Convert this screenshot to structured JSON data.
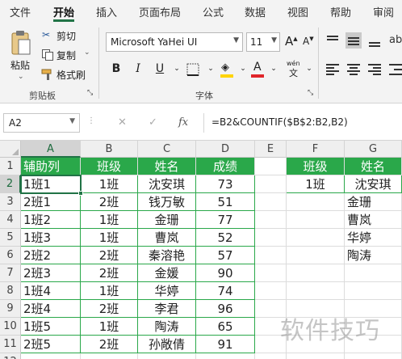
{
  "ribbon_tabs": [
    "文件",
    "开始",
    "插入",
    "页面布局",
    "公式",
    "数据",
    "视图",
    "帮助",
    "审阅"
  ],
  "clipboard": {
    "paste_label": "粘贴",
    "cut_label": "剪切",
    "copy_label": "复制",
    "format_painter_label": "格式刷",
    "group_label": "剪贴板"
  },
  "font": {
    "name": "Microsoft YaHei UI",
    "size": "11",
    "bold": "B",
    "italic": "I",
    "underline": "U",
    "phonetic": "wén",
    "group_label": "字体",
    "highlight_color": "#ffd400",
    "font_color": "#e0252a"
  },
  "formula_bar": {
    "name_box": "A2",
    "cancel_icon": "close-icon",
    "enter_icon": "check-icon",
    "fx": "fx",
    "formula": "=B2&COUNTIF($B$2:B2,B2)"
  },
  "sheet": {
    "columns": [
      "A",
      "B",
      "C",
      "D",
      "E",
      "F",
      "G"
    ],
    "rows": [
      "1",
      "2",
      "3",
      "4",
      "5",
      "6",
      "7",
      "8",
      "9",
      "10",
      "11",
      "12"
    ],
    "table_header": [
      "辅助列",
      "班级",
      "姓名",
      "成绩"
    ],
    "table_rows": [
      [
        "1班1",
        "1班",
        "沈安琪",
        "73"
      ],
      [
        "2班1",
        "2班",
        "钱万敏",
        "51"
      ],
      [
        "1班2",
        "1班",
        "金珊",
        "77"
      ],
      [
        "1班3",
        "1班",
        "曹岚",
        "52"
      ],
      [
        "2班2",
        "2班",
        "秦溶艳",
        "57"
      ],
      [
        "2班3",
        "2班",
        "金媛",
        "90"
      ],
      [
        "1班4",
        "1班",
        "华婷",
        "74"
      ],
      [
        "2班4",
        "2班",
        "李君",
        "96"
      ],
      [
        "1班5",
        "1班",
        "陶涛",
        "65"
      ],
      [
        "2班5",
        "2班",
        "孙敞倩",
        "91"
      ]
    ],
    "lookup_header": [
      "班级",
      "姓名"
    ],
    "lookup_rows": [
      [
        "1班",
        "沈安琪"
      ],
      [
        "",
        "金珊"
      ],
      [
        "",
        "曹岚"
      ],
      [
        "",
        "华婷"
      ],
      [
        "",
        "陶涛"
      ]
    ],
    "header_color": "#2aa84a",
    "selection_color": "#217346"
  },
  "watermark": "软件技巧"
}
